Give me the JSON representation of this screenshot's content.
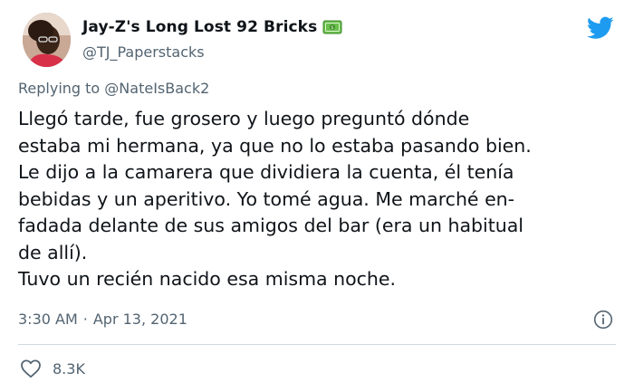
{
  "author": {
    "display_name": "Jay-Z's Long Lost 92 Bricks",
    "handle": "@TJ_Paperstacks",
    "badge_icon": "money-bill-icon"
  },
  "reply": {
    "prefix": "Replying to",
    "mention": "@NateIsBack2"
  },
  "tweet": {
    "text": "Llegó tarde, fue grosero y luego preguntó dónde\nestaba mi hermana, ya que no lo estaba pasando bien.\nLe dijo a la camarera que dividiera la cuenta, él tenía\nbebidas y un aperitivo. Yo tomé agua. Me marché en-\nfadada delante de sus amigos del bar (era un habitual\nde allí).\nTuvo un recién nacido esa misma noche.",
    "time": "3:30 AM",
    "separator": "·",
    "date": "Apr 13, 2021"
  },
  "engagement": {
    "likes": "8.3K"
  },
  "colors": {
    "twitter_blue": "#1d9bf0",
    "secondary_text": "#536471",
    "primary_text": "#0f1419",
    "divider": "#cfd9de",
    "money_green": "#6abf4b"
  }
}
